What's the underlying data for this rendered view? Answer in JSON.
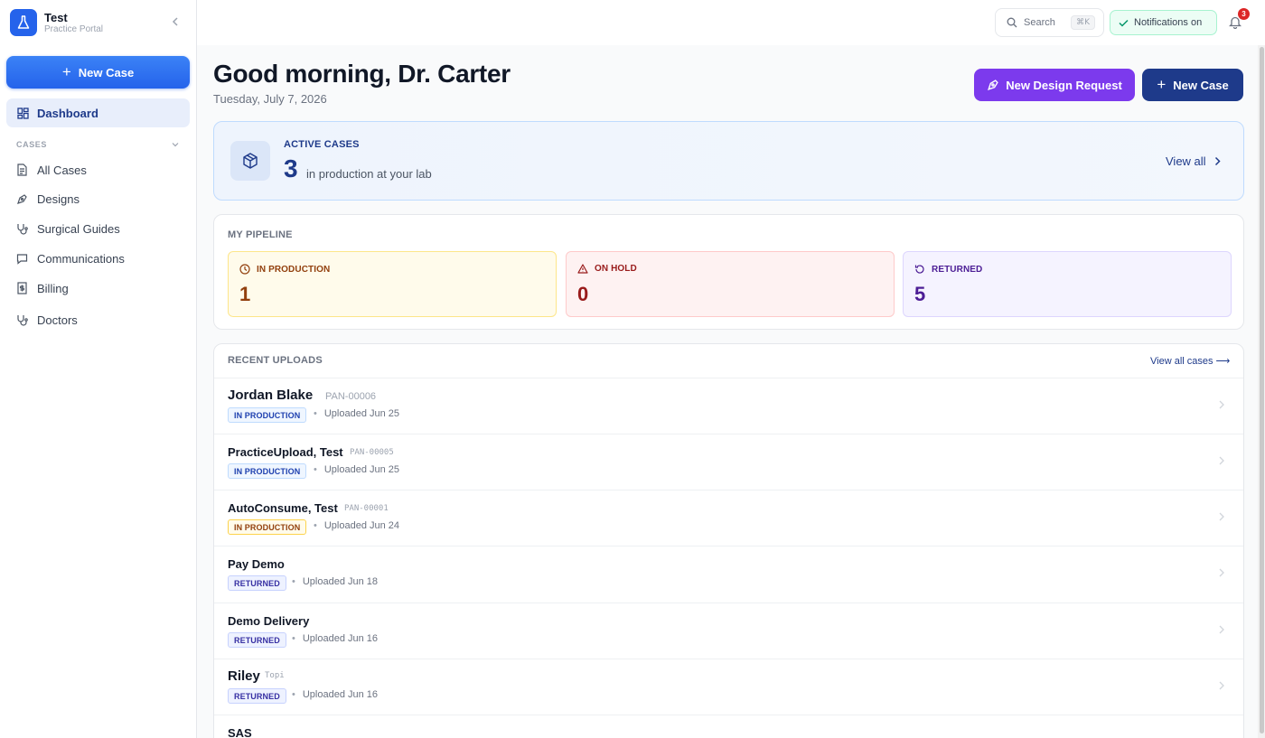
{
  "brand": {
    "title": "Test",
    "subtitle": "Practice Portal"
  },
  "sidebar": {
    "new_case_label": "New Case",
    "active_item": "Dashboard",
    "section_label": "CASES",
    "items": [
      {
        "label": "All Cases",
        "icon": "document-icon"
      },
      {
        "label": "Designs",
        "icon": "pen-tool-icon"
      },
      {
        "label": "Surgical Guides",
        "icon": "stethoscope-icon"
      },
      {
        "label": "Communications",
        "icon": "chat-icon"
      },
      {
        "label": "Billing",
        "icon": "receipt-icon"
      },
      {
        "label": "Doctors",
        "icon": "stethoscope-icon"
      }
    ]
  },
  "topbar": {
    "search_label": "Search",
    "search_shortcut": "⌘K",
    "notifications_label": "Notifications on",
    "notification_count": "3"
  },
  "header": {
    "greeting": "Good morning, Dr. Carter",
    "date": "Tuesday, July 7, 2026",
    "design_request_label": "New Design Request",
    "new_case_label": "New Case"
  },
  "active_cases": {
    "label": "ACTIVE CASES",
    "count": "3",
    "description": "in production at your lab",
    "view_all": "View all"
  },
  "pipeline": {
    "title": "MY PIPELINE",
    "cards": [
      {
        "label": "IN PRODUCTION",
        "value": "1",
        "color": "#92400e"
      },
      {
        "label": "ON HOLD",
        "value": "0",
        "color": "#991b1b"
      },
      {
        "label": "RETURNED",
        "value": "5",
        "color": "#4c1d95"
      }
    ]
  },
  "uploads": {
    "title": "RECENT UPLOADS",
    "view_all": "View all cases ⟶",
    "rows": [
      {
        "name": "Jordan Blake",
        "case_id": "PAN-00006",
        "status": "IN PRODUCTION",
        "uploaded": "Uploaded Jun 25"
      },
      {
        "name": "PracticeUpload, Test",
        "case_id": "PAN-00005",
        "status": "IN PRODUCTION",
        "uploaded": "Uploaded Jun 25"
      },
      {
        "name": "AutoConsume, Test",
        "case_id": "PAN-00001",
        "status": "IN PRODUCTION",
        "uploaded": "Uploaded Jun 24"
      },
      {
        "name": "Pay Demo",
        "case_id": "",
        "status": "RETURNED",
        "uploaded": "Uploaded Jun 18"
      },
      {
        "name": "Demo Delivery",
        "case_id": "",
        "status": "RETURNED",
        "uploaded": "Uploaded Jun 16"
      },
      {
        "name": "Riley",
        "case_id": "Topi",
        "status": "RETURNED",
        "uploaded": "Uploaded Jun 16"
      },
      {
        "name": "SAS",
        "case_id": "",
        "status": "",
        "uploaded": ""
      }
    ]
  }
}
